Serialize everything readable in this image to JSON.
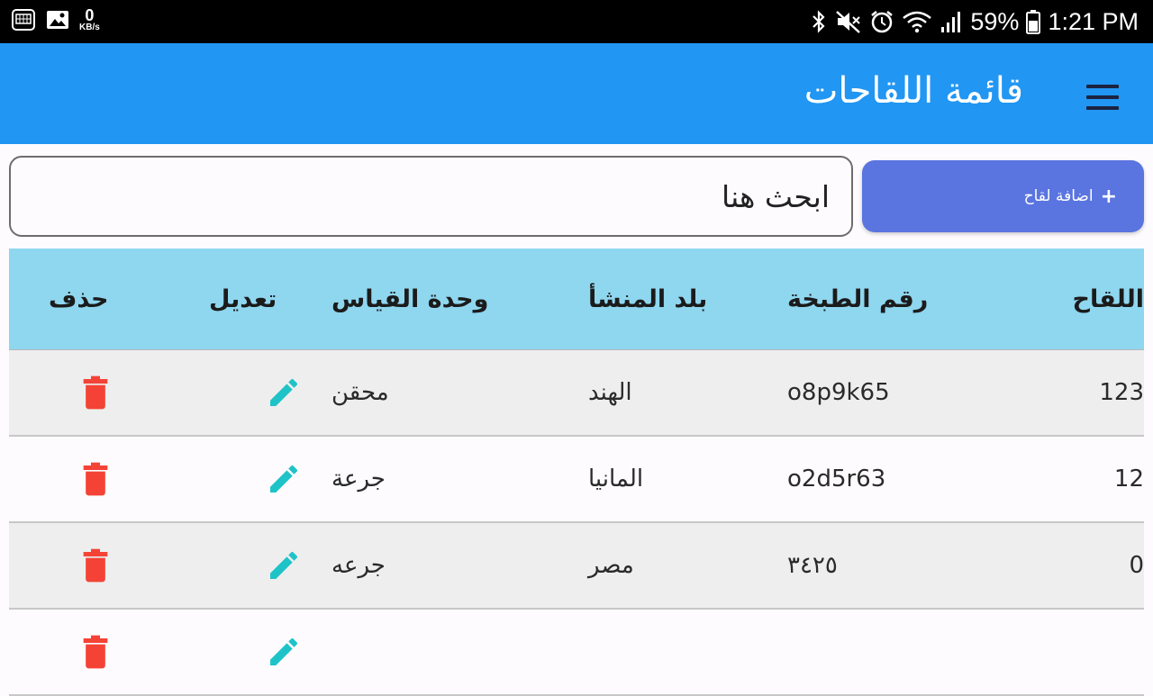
{
  "status_bar": {
    "net_speed_value": "0",
    "net_speed_unit": "KB/s",
    "battery": "59%",
    "time": "1:21 PM",
    "icons": [
      "keyboard-icon",
      "gallery-icon",
      "bluetooth-icon",
      "mute-icon",
      "alarm-icon",
      "wifi-icon",
      "signal-icon",
      "battery-icon"
    ]
  },
  "app_bar": {
    "title": "قائمة اللقاحات",
    "menu_icon": "menu-icon",
    "color": "#2196f3"
  },
  "search": {
    "placeholder": "ابحث هنا"
  },
  "add_button": {
    "label": "اضافة لقاح",
    "icon": "+",
    "color": "#5a74e0"
  },
  "table": {
    "headers": {
      "id": "اللقاح",
      "batch": "رقم الطبخة",
      "country": "بلد المنشأ",
      "unit": "وحدة القياس",
      "edit": "تعديل",
      "delete": "حذف"
    },
    "header_color": "#8fd6ef",
    "rows": [
      {
        "id": "123",
        "batch": "o8p9k65",
        "country": "الهند",
        "unit": "محقن"
      },
      {
        "id": "12",
        "batch": "o2d5r63",
        "country": "المانيا",
        "unit": "جرعة"
      },
      {
        "id": "0",
        "batch": "٣٤٢٥",
        "country": "مصر",
        "unit": "جرعه"
      }
    ],
    "edit_icon_color": "#1ec3c8",
    "delete_icon_color": "#f44336"
  }
}
